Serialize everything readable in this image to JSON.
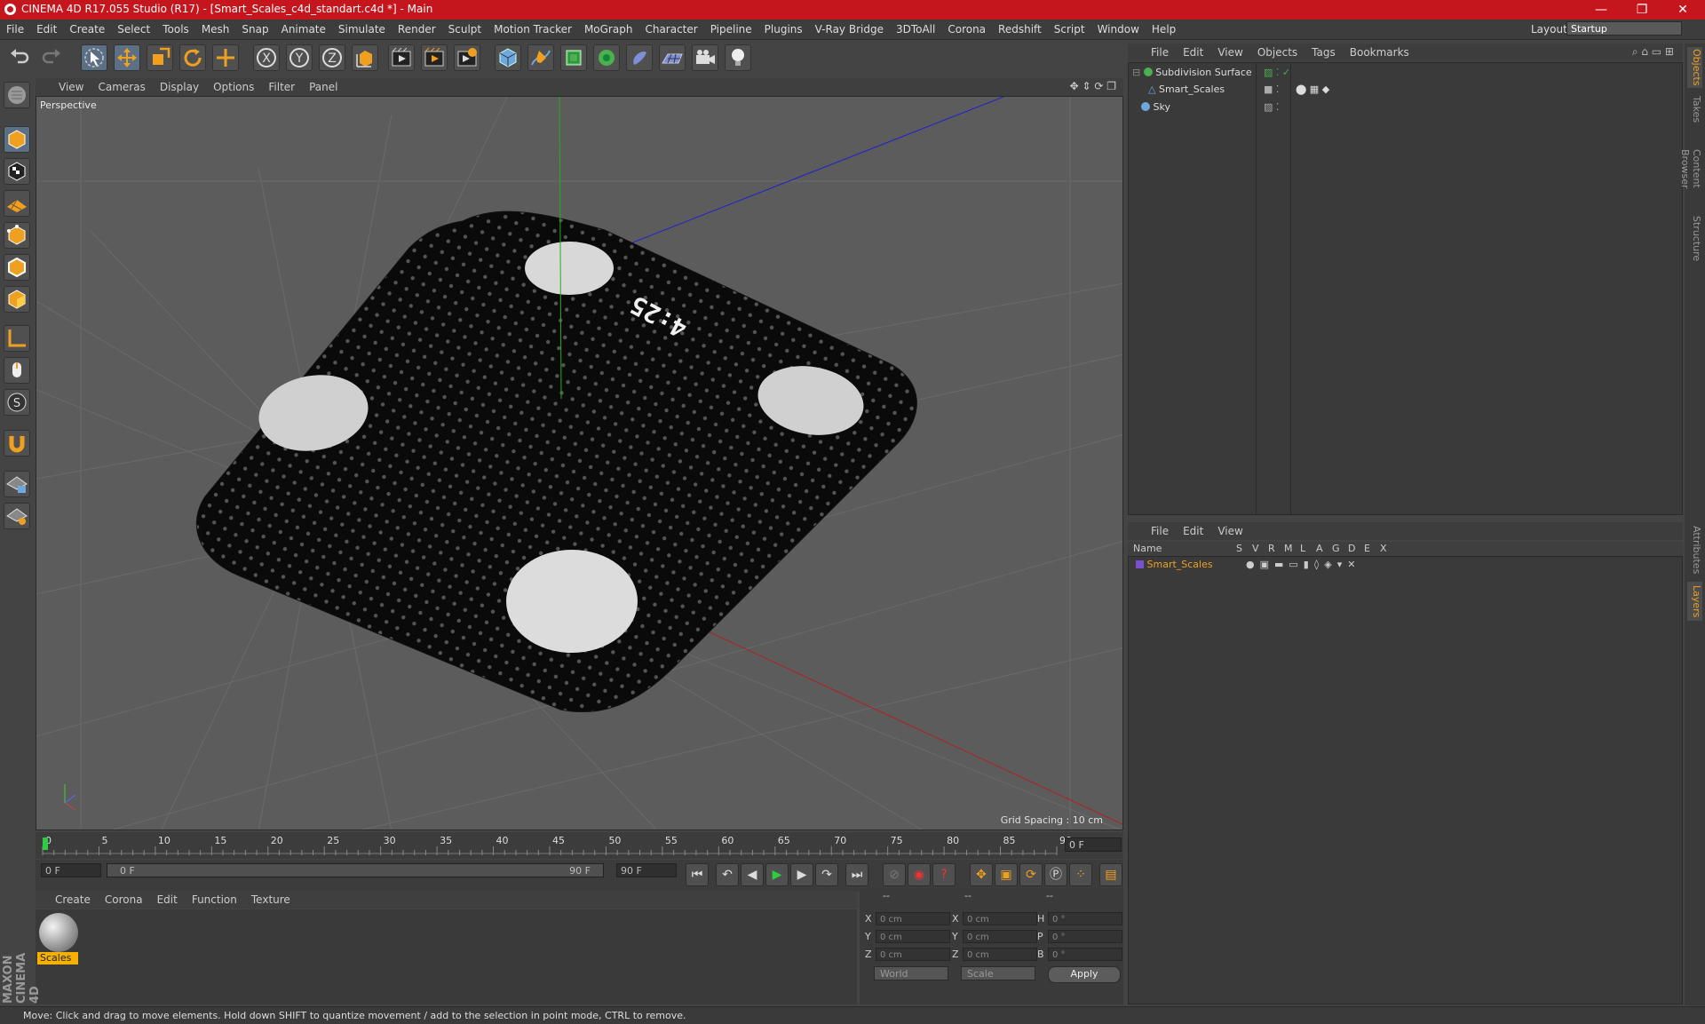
{
  "window": {
    "title": "CINEMA 4D R17.055 Studio (R17) - [Smart_Scales_c4d_standart.c4d *] - Main",
    "minimize": "—",
    "maximize": "❐",
    "close": "✕"
  },
  "menu": [
    "File",
    "Edit",
    "Create",
    "Select",
    "Tools",
    "Mesh",
    "Snap",
    "Animate",
    "Simulate",
    "Render",
    "Sculpt",
    "Motion Tracker",
    "MoGraph",
    "Character",
    "Pipeline",
    "Plugins",
    "V-Ray Bridge",
    "3DToAll",
    "Corona",
    "Redshift",
    "Script",
    "Window",
    "Help"
  ],
  "layout": {
    "label": "Layout:",
    "value": "Startup"
  },
  "viewport": {
    "menu": [
      "View",
      "Cameras",
      "Display",
      "Options",
      "Filter",
      "Panel"
    ],
    "label": "Perspective",
    "grid_spacing": "Grid Spacing : 10 cm",
    "scale_display": "4:25"
  },
  "timeline": {
    "ticks": [
      "0",
      "5",
      "10",
      "15",
      "20",
      "25",
      "30",
      "35",
      "40",
      "45",
      "50",
      "55",
      "60",
      "65",
      "70",
      "75",
      "80",
      "85",
      "90"
    ],
    "current_frame": "0 F",
    "start_field": "0 F",
    "range_start": "0 F",
    "range_end": "90 F",
    "end_field": "90 F"
  },
  "materials": {
    "menu": [
      "Create",
      "Corona",
      "Edit",
      "Function",
      "Texture"
    ],
    "items": [
      {
        "name": "Scales"
      }
    ]
  },
  "coords": {
    "header_a": "--",
    "header_b": "--",
    "header_c": "--",
    "rows": [
      {
        "a_label": "X",
        "a_val": "0 cm",
        "b_label": "X",
        "b_val": "0 cm",
        "c_label": "H",
        "c_val": "0 °"
      },
      {
        "a_label": "Y",
        "a_val": "0 cm",
        "b_label": "Y",
        "b_val": "0 cm",
        "c_label": "P",
        "c_val": "0 °"
      },
      {
        "a_label": "Z",
        "a_val": "0 cm",
        "b_label": "Z",
        "b_val": "0 cm",
        "c_label": "B",
        "c_val": "0 °"
      }
    ],
    "space": "World",
    "mode": "Scale",
    "apply": "Apply"
  },
  "objects": {
    "menu": [
      "File",
      "Edit",
      "View",
      "Objects",
      "Tags",
      "Bookmarks"
    ],
    "items": [
      {
        "name": "Subdivision Surface"
      },
      {
        "name": "Smart_Scales"
      },
      {
        "name": "Sky"
      }
    ]
  },
  "layers": {
    "menu": [
      "File",
      "Edit",
      "View"
    ],
    "columns": [
      "Name",
      "S",
      "V",
      "R",
      "M",
      "L",
      "A",
      "G",
      "D",
      "E",
      "X"
    ],
    "items": [
      {
        "name": "Smart_Scales"
      }
    ]
  },
  "side_tabs": [
    "Objects",
    "Takes",
    "Content Browser",
    "Structure",
    "Attributes",
    "Layers"
  ],
  "status": "Move: Click and drag to move elements. Hold down SHIFT to quantize movement / add to the selection in point mode, CTRL to remove.",
  "brand": "MAXON CINEMA 4D",
  "colors": {
    "title_bar": "#c4161c",
    "accent": "#f0a020",
    "selection": "#5b6f85"
  }
}
